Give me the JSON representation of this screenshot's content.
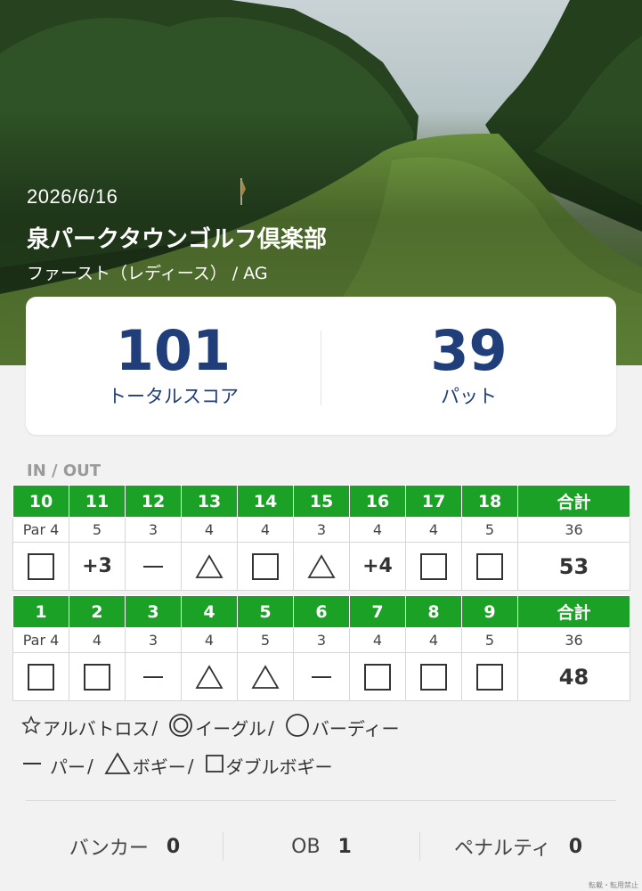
{
  "round": {
    "date": "2026/6/16",
    "course": "泉パークタウンゴルフ倶楽部",
    "tee": "ファースト（レディース） / AG"
  },
  "summary": {
    "total_score": "101",
    "total_label": "トータルスコア",
    "putts": "39",
    "putts_label": "パット"
  },
  "section_label": "IN / OUT",
  "tables": [
    {
      "holes": [
        "10",
        "11",
        "12",
        "13",
        "14",
        "15",
        "16",
        "17",
        "18",
        "合計"
      ],
      "pars": [
        "Par 4",
        "5",
        "3",
        "4",
        "4",
        "3",
        "4",
        "4",
        "5",
        "36"
      ],
      "results": [
        {
          "symbol": "box"
        },
        {
          "text": "+3"
        },
        {
          "symbol": "dash"
        },
        {
          "symbol": "triangle"
        },
        {
          "symbol": "box"
        },
        {
          "symbol": "triangle"
        },
        {
          "text": "+4"
        },
        {
          "symbol": "box"
        },
        {
          "symbol": "box"
        },
        {
          "text": "53"
        }
      ]
    },
    {
      "holes": [
        "1",
        "2",
        "3",
        "4",
        "5",
        "6",
        "7",
        "8",
        "9",
        "合計"
      ],
      "pars": [
        "Par 4",
        "4",
        "3",
        "4",
        "5",
        "3",
        "4",
        "4",
        "5",
        "36"
      ],
      "results": [
        {
          "symbol": "box"
        },
        {
          "symbol": "box"
        },
        {
          "symbol": "dash"
        },
        {
          "symbol": "triangle"
        },
        {
          "symbol": "triangle"
        },
        {
          "symbol": "dash"
        },
        {
          "symbol": "box"
        },
        {
          "symbol": "box"
        },
        {
          "symbol": "box"
        },
        {
          "text": "48"
        }
      ]
    }
  ],
  "legend": {
    "albatross": "アルバトロス",
    "eagle": "イーグル",
    "birdie": "バーディー",
    "par": "パー",
    "bogey": "ボギー",
    "double_bogey": "ダブルボギー",
    "sep": "/"
  },
  "stats": {
    "bunker_label": "バンカー",
    "bunker": "0",
    "ob_label": "OB",
    "ob": "1",
    "penalty_label": "ペナルティ",
    "penalty": "0"
  },
  "copyright": "転載・転用禁止",
  "colors": {
    "header_green": "#1aa126",
    "score_blue": "#1f3e7a"
  }
}
